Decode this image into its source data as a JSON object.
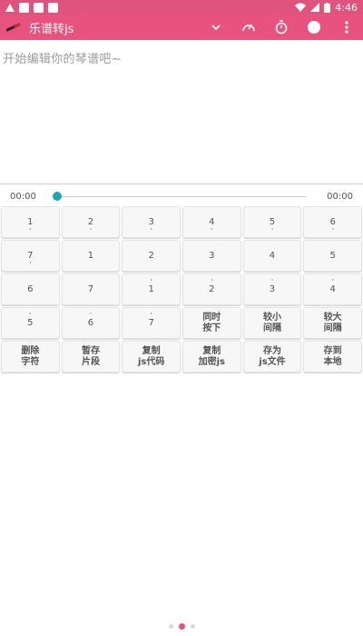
{
  "status_bar": {
    "time": "4:46"
  },
  "app_bar": {
    "title": "乐谱转js"
  },
  "editor": {
    "placeholder": "开始编辑你的琴谱吧~"
  },
  "timeline": {
    "start_time": "00:00",
    "end_time": "00:00",
    "progress": 0.0
  },
  "keys": [
    {
      "top": "",
      "main": "1",
      "bottom": "·"
    },
    {
      "top": "",
      "main": "2",
      "bottom": "·"
    },
    {
      "top": "",
      "main": "3",
      "bottom": "·"
    },
    {
      "top": "",
      "main": "4",
      "bottom": "·"
    },
    {
      "top": "",
      "main": "5",
      "bottom": "·"
    },
    {
      "top": "",
      "main": "6",
      "bottom": "·"
    },
    {
      "top": "",
      "main": "7",
      "bottom": "·"
    },
    {
      "top": "",
      "main": "1",
      "bottom": ""
    },
    {
      "top": "",
      "main": "2",
      "bottom": ""
    },
    {
      "top": "",
      "main": "3",
      "bottom": ""
    },
    {
      "top": "",
      "main": "4",
      "bottom": ""
    },
    {
      "top": "",
      "main": "5",
      "bottom": ""
    },
    {
      "top": "",
      "main": "6",
      "bottom": ""
    },
    {
      "top": "",
      "main": "7",
      "bottom": ""
    },
    {
      "top": "·",
      "main": "1",
      "bottom": ""
    },
    {
      "top": "·",
      "main": "2",
      "bottom": ""
    },
    {
      "top": "·",
      "main": "3",
      "bottom": ""
    },
    {
      "top": "·",
      "main": "4",
      "bottom": ""
    },
    {
      "top": "·",
      "main": "5",
      "bottom": ""
    },
    {
      "top": "·",
      "main": "6",
      "bottom": ""
    },
    {
      "top": "·",
      "main": "7",
      "bottom": ""
    }
  ],
  "action_keys": [
    {
      "line1": "同时",
      "line2": "按下"
    },
    {
      "line1": "较小",
      "line2": "间隔"
    },
    {
      "line1": "较大",
      "line2": "间隔"
    },
    {
      "line1": "删除",
      "line2": "字符"
    },
    {
      "line1": "暂存",
      "line2": "片段"
    },
    {
      "line1": "复制",
      "line2": "js代码"
    },
    {
      "line1": "复制",
      "line2": "加密js"
    },
    {
      "line1": "存为",
      "line2": "js文件"
    },
    {
      "line1": "存到",
      "line2": "本地"
    }
  ],
  "colors": {
    "accent": "#e8527e",
    "slider_thumb": "#1ca6ae"
  },
  "icons": [
    "chevron-down-icon",
    "speedometer-icon",
    "stopwatch-icon",
    "compass-icon",
    "more-vert-icon"
  ],
  "pager": {
    "count": 3,
    "active": 1
  }
}
